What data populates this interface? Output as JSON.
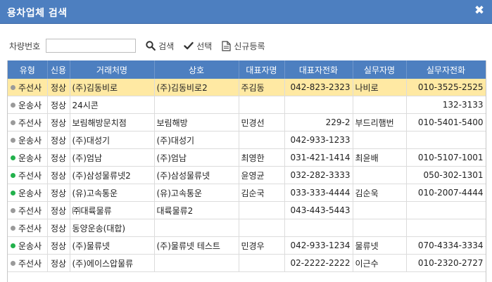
{
  "dialog": {
    "title": "용차업체 검색",
    "close_glyph": "✖"
  },
  "toolbar": {
    "vehicle_label": "차량번호",
    "vehicle_value": "",
    "search_label": "검색",
    "select_label": "선택",
    "new_label": "신규등록"
  },
  "columns": [
    "유형",
    "신용",
    "거래처명",
    "상호",
    "대표자명",
    "대표자전화",
    "실무자명",
    "실무자전화"
  ],
  "rows": [
    {
      "status": "gray",
      "type": "주선사",
      "credit": "정상",
      "client": "(주)김동비로",
      "company": "(주)김동비로2",
      "rep": "주김동",
      "rep_phone": "042-823-2323",
      "staff": "나비로",
      "staff_phone": "010-3525-2525",
      "selected": true
    },
    {
      "status": "gray",
      "type": "운송사",
      "credit": "정상",
      "client": "24시콘",
      "company": "",
      "rep": "",
      "rep_phone": "",
      "staff": "",
      "staff_phone": "132-3133",
      "selected": false
    },
    {
      "status": "gray",
      "type": "주선사",
      "credit": "정상",
      "client": "보림해방문치점",
      "company": "보림해방",
      "rep": "민경선",
      "rep_phone": "229-2",
      "staff": "부드리햄번",
      "staff_phone": "010-5401-5400",
      "selected": false
    },
    {
      "status": "gray",
      "type": "운송사",
      "credit": "정상",
      "client": "(주)대성기",
      "company": "(주)대성기",
      "rep": "",
      "rep_phone": "042-933-1233",
      "staff": "",
      "staff_phone": "",
      "selected": false
    },
    {
      "status": "green",
      "type": "운송사",
      "credit": "정상",
      "client": "(주)엄남",
      "company": "(주)엄남",
      "rep": "최영한",
      "rep_phone": "031-421-1414",
      "staff": "최윤배",
      "staff_phone": "010-5107-1001",
      "selected": false
    },
    {
      "status": "green",
      "type": "주선사",
      "credit": "정상",
      "client": "(주)삼성물류넷2",
      "company": "(주)삼성물류넷",
      "rep": "윤영균",
      "rep_phone": "032-282-3333",
      "staff": "",
      "staff_phone": "050-302-1301",
      "selected": false
    },
    {
      "status": "green",
      "type": "운송사",
      "credit": "정상",
      "client": "(유)고속통운",
      "company": "(유)고속통운",
      "rep": "김순국",
      "rep_phone": "033-333-4444",
      "staff": "김순욱",
      "staff_phone": "010-2007-4444",
      "selected": false
    },
    {
      "status": "gray",
      "type": "주선사",
      "credit": "정상",
      "client": "㈜대륙물류",
      "company": "대륙물류2",
      "rep": "",
      "rep_phone": "043-443-5443",
      "staff": "",
      "staff_phone": "",
      "selected": false
    },
    {
      "status": "gray",
      "type": "주선사",
      "credit": "정상",
      "client": "동양운송(대합)",
      "company": "",
      "rep": "",
      "rep_phone": "",
      "staff": "",
      "staff_phone": "",
      "selected": false
    },
    {
      "status": "green",
      "type": "운송사",
      "credit": "정상",
      "client": "(주)물류넷",
      "company": "(주)물류넷 테스트",
      "rep": "민경우",
      "rep_phone": "042-933-1234",
      "staff": "물류넷",
      "staff_phone": "070-4334-3334",
      "selected": false
    },
    {
      "status": "gray",
      "type": "주선사",
      "credit": "정상",
      "client": "(주)에이스압물류",
      "company": "",
      "rep": "",
      "rep_phone": "02-2222-2222",
      "staff": "이근수",
      "staff_phone": "010-2320-2727",
      "selected": false
    }
  ]
}
